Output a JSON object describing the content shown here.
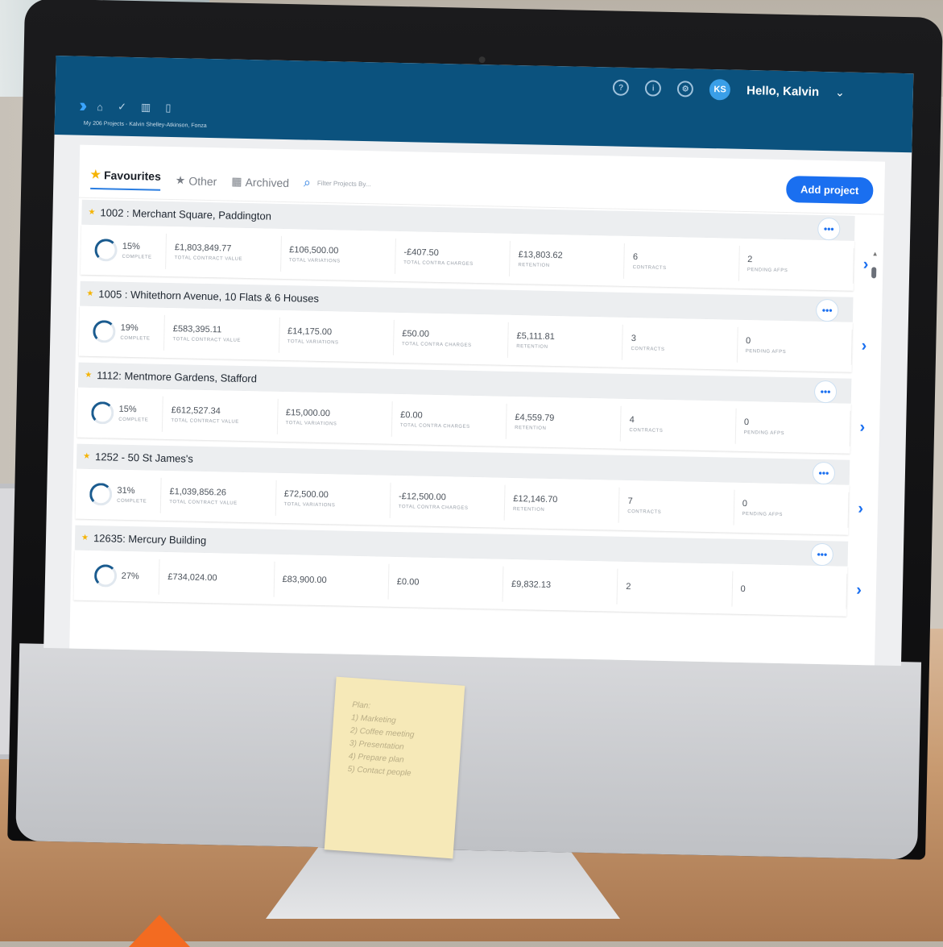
{
  "header": {
    "greeting": "Hello, Kalvin",
    "avatar_initials": "KS",
    "breadcrumb": "My 206 Projects - Kalvin Shelley-Atkinson, Fonza"
  },
  "tabs": [
    {
      "label": "Favourites",
      "active": true
    },
    {
      "label": "Other",
      "active": false
    },
    {
      "label": "Archived",
      "active": false
    }
  ],
  "search": {
    "placeholder": "Filter Projects By..."
  },
  "add_button": "Add project",
  "labels": {
    "complete": "COMPLETE",
    "contract_value": "TOTAL CONTRACT VALUE",
    "variations": "TOTAL VARIATIONS",
    "contra": "TOTAL CONTRA CHARGES",
    "retention": "RETENTION",
    "contracts": "CONTRACTS",
    "pending": "PENDING AFPS"
  },
  "projects": [
    {
      "name": "1002 : Merchant Square, Paddington",
      "complete": "15%",
      "contract_value": "£1,803,849.77",
      "variations": "£106,500.00",
      "contra": "-£407.50",
      "retention": "£13,803.62",
      "contracts": "6",
      "pending": "2"
    },
    {
      "name": "1005 : Whitethorn Avenue, 10 Flats & 6 Houses",
      "complete": "19%",
      "contract_value": "£583,395.11",
      "variations": "£14,175.00",
      "contra": "£50.00",
      "retention": "£5,111.81",
      "contracts": "3",
      "pending": "0"
    },
    {
      "name": "1112: Mentmore Gardens, Stafford",
      "complete": "15%",
      "contract_value": "£612,527.34",
      "variations": "£15,000.00",
      "contra": "£0.00",
      "retention": "£4,559.79",
      "contracts": "4",
      "pending": "0"
    },
    {
      "name": "1252 - 50 St James's",
      "complete": "31%",
      "contract_value": "£1,039,856.26",
      "variations": "£72,500.00",
      "contra": "-£12,500.00",
      "retention": "£12,146.70",
      "contracts": "7",
      "pending": "0"
    },
    {
      "name": "12635: Mercury Building",
      "complete": "27%",
      "contract_value": "£734,024.00",
      "variations": "£83,900.00",
      "contra": "£0.00",
      "retention": "£9,832.13",
      "contracts": "2",
      "pending": "0"
    }
  ],
  "note": {
    "lines": [
      "Plan:",
      "1) Marketing",
      "2) Coffee meeting",
      "3) Presentation",
      "4) Prepare plan",
      "5) Contact people"
    ]
  }
}
